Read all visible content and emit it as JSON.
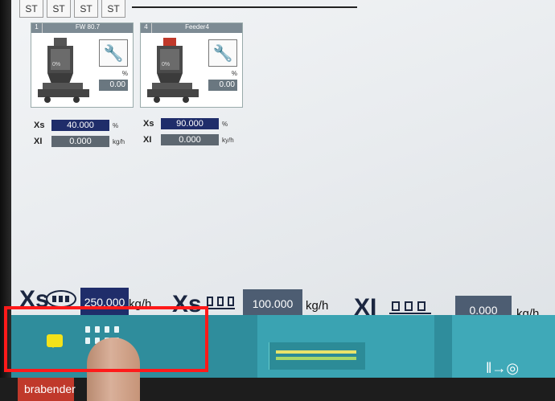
{
  "tabs": [
    "ST",
    "ST",
    "ST",
    "ST"
  ],
  "feeders": [
    {
      "number": "1",
      "name": "FW 80.7",
      "fill": "0%",
      "pct_label": "%",
      "pct_value": "0.00",
      "xs_label": "Xs",
      "xs_value": "40.000",
      "xs_unit": "%",
      "xi_label": "XI",
      "xi_value": "0.000",
      "xi_unit": "kg/h"
    },
    {
      "number": "4",
      "name": "Feeder4",
      "fill": "0%",
      "pct_label": "%",
      "pct_value": "0.00",
      "xs_label": "Xs",
      "xs_value": "90.000",
      "xs_unit": "%",
      "xi_label": "XI",
      "xi_value": "0.000",
      "xi_unit": "ky/h"
    }
  ],
  "summary": {
    "total_label": "Xs",
    "total_value": "250.000",
    "total_unit": "kg/h",
    "xs_label": "Xs",
    "xs_value": "100.000",
    "xs_unit": "kg/h",
    "xi_label": "XI",
    "xi_value": "0.000",
    "xi_unit": "kg/h"
  },
  "brand": "brabender",
  "colors": {
    "toolbar": "#2f8d9c",
    "field_dark": "#1f2d6a",
    "highlight": "#ff1a1a",
    "message": "#f3e21a"
  }
}
